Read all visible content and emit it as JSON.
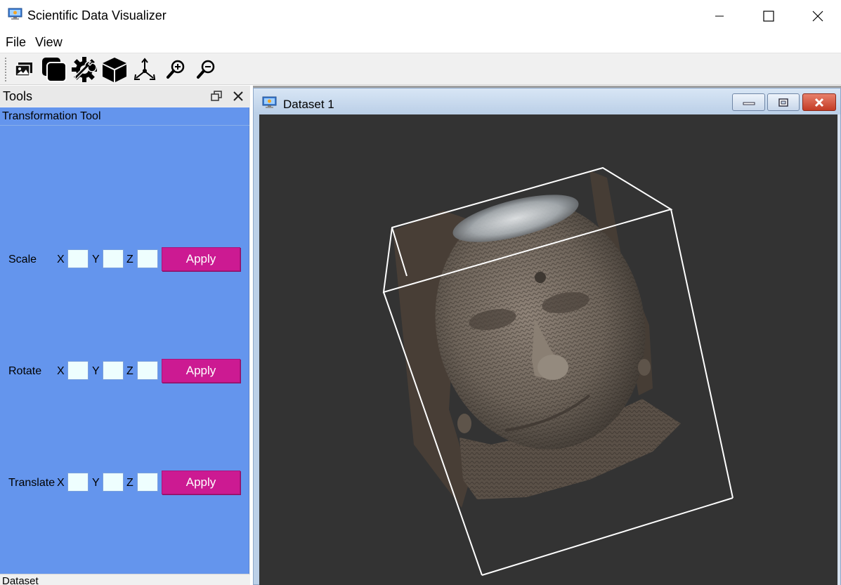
{
  "window": {
    "title": "Scientific Data Visualizer",
    "icon": "monitor-app-icon"
  },
  "menu": {
    "items": [
      {
        "label": "File"
      },
      {
        "label": "View"
      }
    ]
  },
  "toolbar": {
    "buttons": [
      {
        "icon": "open-image-icon"
      },
      {
        "icon": "copy-windows-icon"
      },
      {
        "icon": "settings-wrench-icon"
      },
      {
        "icon": "cube-icon"
      },
      {
        "icon": "axes-transform-icon"
      },
      {
        "icon": "zoom-in-icon"
      },
      {
        "icon": "zoom-out-icon"
      }
    ]
  },
  "tools_dock": {
    "title": "Tools",
    "heading": "Transformation Tool",
    "rows": [
      {
        "label": "Scale",
        "x_label": "X",
        "y_label": "Y",
        "z_label": "Z",
        "x_value": "",
        "y_value": "",
        "z_value": "",
        "button": "Apply"
      },
      {
        "label": "Rotate",
        "x_label": "X",
        "y_label": "Y",
        "z_label": "Z",
        "x_value": "",
        "y_value": "",
        "z_value": "",
        "button": "Apply"
      },
      {
        "label": "Translate",
        "x_label": "X",
        "y_label": "Y",
        "z_label": "Z",
        "x_value": "",
        "y_value": "",
        "z_value": "",
        "button": "Apply"
      }
    ],
    "bottom_dock_title": "Dataset"
  },
  "dataset_window": {
    "title": "Dataset 1"
  },
  "colors": {
    "tool_panel_bg": "#6495ed",
    "apply_button": "#cc1a92",
    "viewport_bg": "#333333",
    "bounding_box": "#ffffff"
  }
}
